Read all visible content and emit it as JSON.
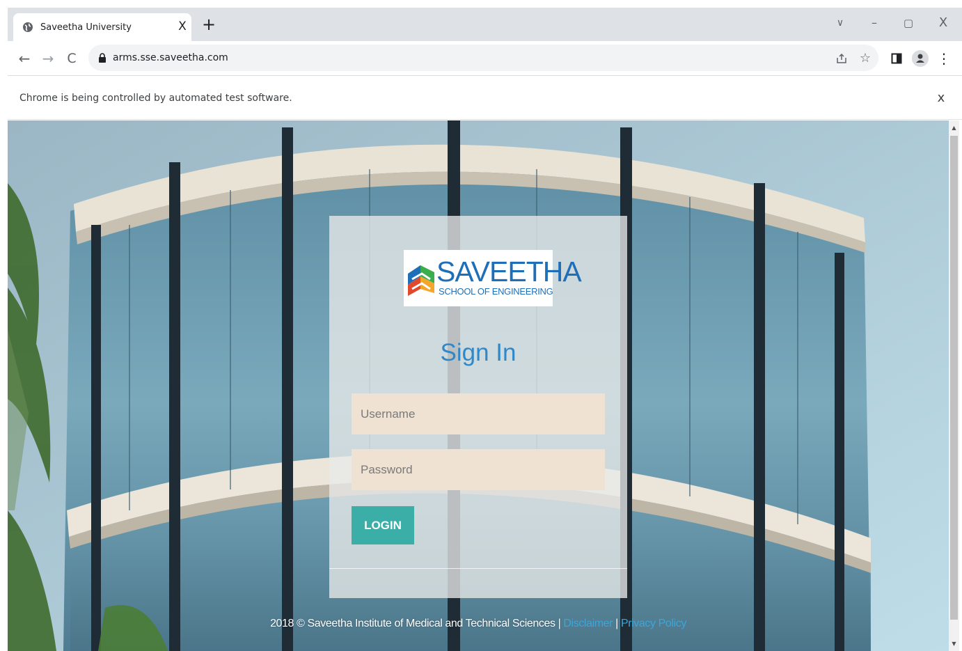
{
  "browser": {
    "tab": {
      "title": "Saveetha University",
      "close": "X",
      "favicon": "globe-icon"
    },
    "new_tab": "+",
    "window_controls": {
      "tab_search": "∨",
      "minimize": "–",
      "restore": "▢",
      "close": "X"
    },
    "nav": {
      "back": "←",
      "forward": "→",
      "reload": "C"
    },
    "address": {
      "url": "arms.sse.saveetha.com",
      "lock_icon": "lock-icon"
    },
    "toolbar_icons": {
      "share": "share-icon",
      "bookmark": "☆",
      "side_panel": "side-panel-icon",
      "profile": "profile-icon",
      "menu": "⋮"
    }
  },
  "infobar": {
    "message": "Chrome is being controlled by automated test software.",
    "close": "x"
  },
  "login": {
    "logo": {
      "main": "SAVEETHA",
      "sub": "SCHOOL OF ENGINEERING"
    },
    "title": "Sign In",
    "username_placeholder": "Username",
    "password_placeholder": "Password",
    "login_button": "LOGIN"
  },
  "footer": {
    "text": "2018 © Saveetha Institute of Medical and Technical Sciences | ",
    "disclaimer": "Disclaimer",
    "separator": " | ",
    "privacy": "Privacy Policy"
  },
  "colors": {
    "accent": "#3aaea7",
    "title_blue": "#2f89c9",
    "link_blue": "#3aa6db",
    "input_bg": "#efe2d3"
  }
}
